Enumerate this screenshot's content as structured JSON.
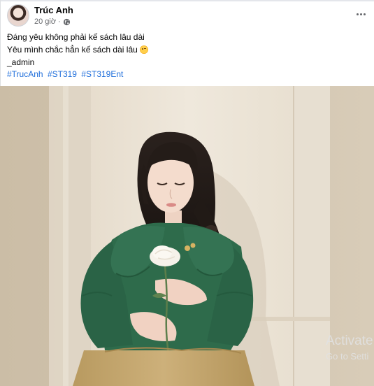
{
  "post": {
    "author": "Trúc Anh",
    "time": "20 giờ",
    "separator": "·",
    "privacy_icon": "globe-icon",
    "more_icon": "more-options-icon"
  },
  "caption": {
    "line1": "Đáng yêu không phải kế sách lâu dài",
    "line2": "Yêu mình chắc hẳn kế sách dài lâu",
    "emoji": "wink-emoji",
    "line3": "_admin"
  },
  "hashtags": [
    "#TrucAnh",
    "#ST319",
    "#ST319Ent"
  ],
  "watermark": {
    "line1": "Activate",
    "line2": "Go to Setti"
  },
  "colors": {
    "link": "#216fdb",
    "text": "#050505",
    "secondary": "#65676b",
    "blouse": "#2d6a4b",
    "skirt": "#c6a76a",
    "wall": "#ece4d7"
  }
}
